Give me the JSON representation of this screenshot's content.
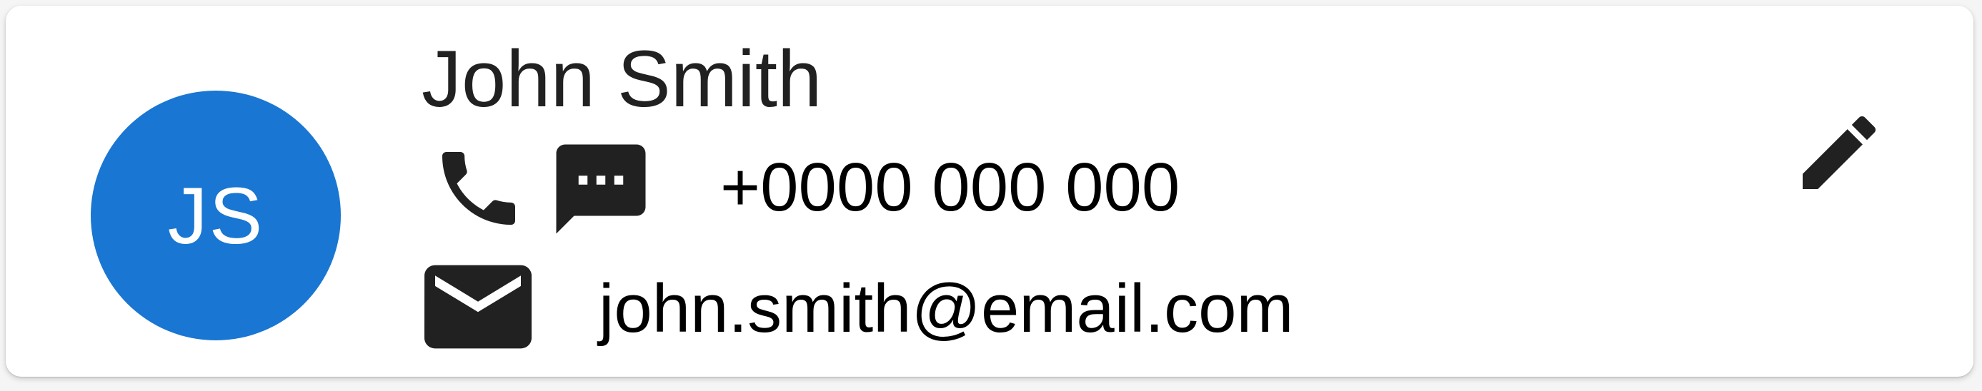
{
  "contact": {
    "initials": "JS",
    "name": "John Smith",
    "phone": "+0000 000 000",
    "email": "john.smith@email.com"
  },
  "colors": {
    "avatar_background": "#1976d2",
    "icon": "#212121",
    "secondary_text": "#757575"
  },
  "icons": {
    "phone": "phone-icon",
    "sms": "sms-icon",
    "email": "mail-icon",
    "edit": "edit-icon"
  }
}
